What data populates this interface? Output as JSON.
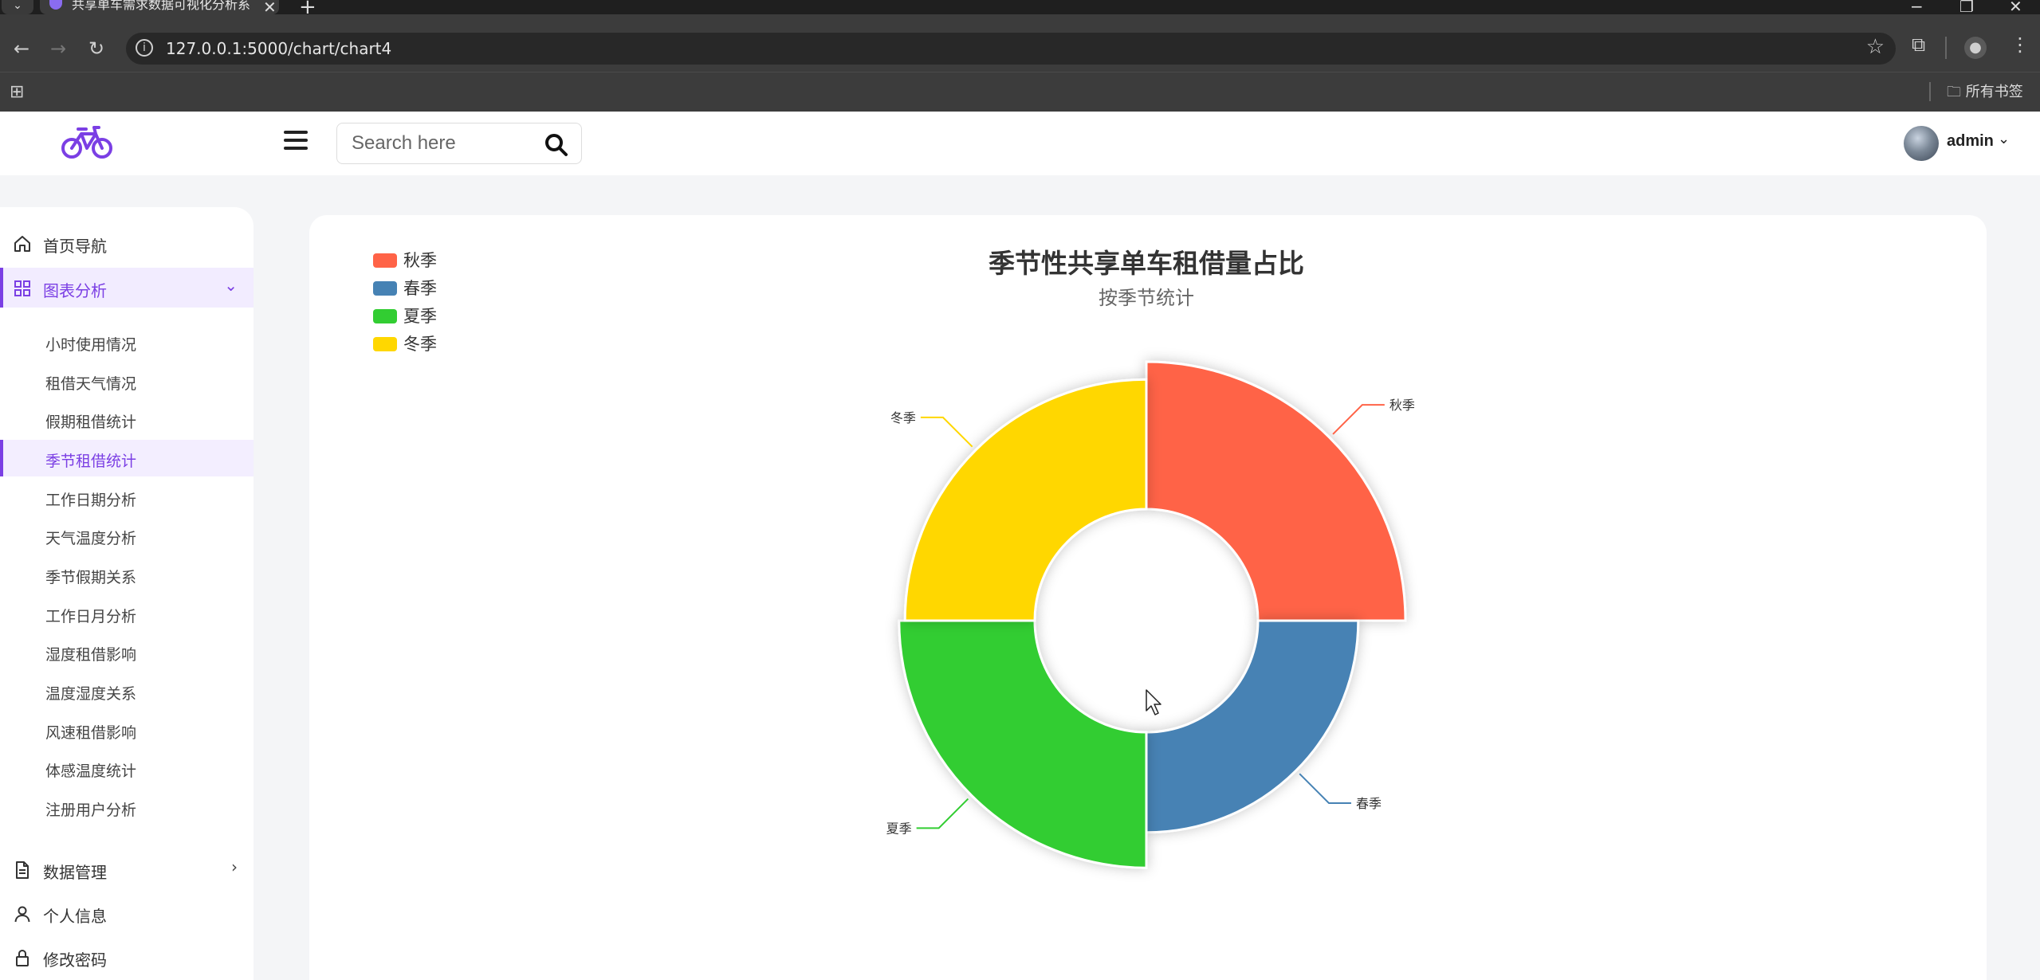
{
  "browser": {
    "tab_title": "共享单车需求数据可视化分析系",
    "url": "127.0.0.1:5000/chart/chart4",
    "bookmarks_folder": "所有书签"
  },
  "header": {
    "search_placeholder": "Search here",
    "user_name": "admin"
  },
  "sidebar": {
    "items": [
      {
        "label": "首页导航",
        "icon": "home-icon"
      },
      {
        "label": "图表分析",
        "icon": "grid-icon"
      }
    ],
    "sub_items": [
      "小时使用情况",
      "租借天气情况",
      "假期租借统计",
      "季节租借统计",
      "工作日期分析",
      "天气温度分析",
      "季节假期关系",
      "工作日月分析",
      "湿度租借影响",
      "温度湿度关系",
      "风速租借影响",
      "体感温度统计",
      "注册用户分析"
    ],
    "bottom_items": [
      {
        "label": "数据管理",
        "icon": "document-icon"
      },
      {
        "label": "个人信息",
        "icon": "user-icon"
      },
      {
        "label": "修改密码",
        "icon": "lock-icon"
      }
    ]
  },
  "chart_data": {
    "type": "pie",
    "title": "季节性共享单车租借量占比",
    "subtitle": "按季节统计",
    "legend_position": "top-left",
    "series": [
      {
        "name": "秋季",
        "value": 1.0,
        "color": "#ff6347"
      },
      {
        "name": "春季",
        "value": 0.68,
        "color": "#4682b4"
      },
      {
        "name": "夏季",
        "value": 0.92,
        "color": "#32cd32"
      },
      {
        "name": "冬季",
        "value": 0.88,
        "color": "#ffd700"
      }
    ]
  }
}
